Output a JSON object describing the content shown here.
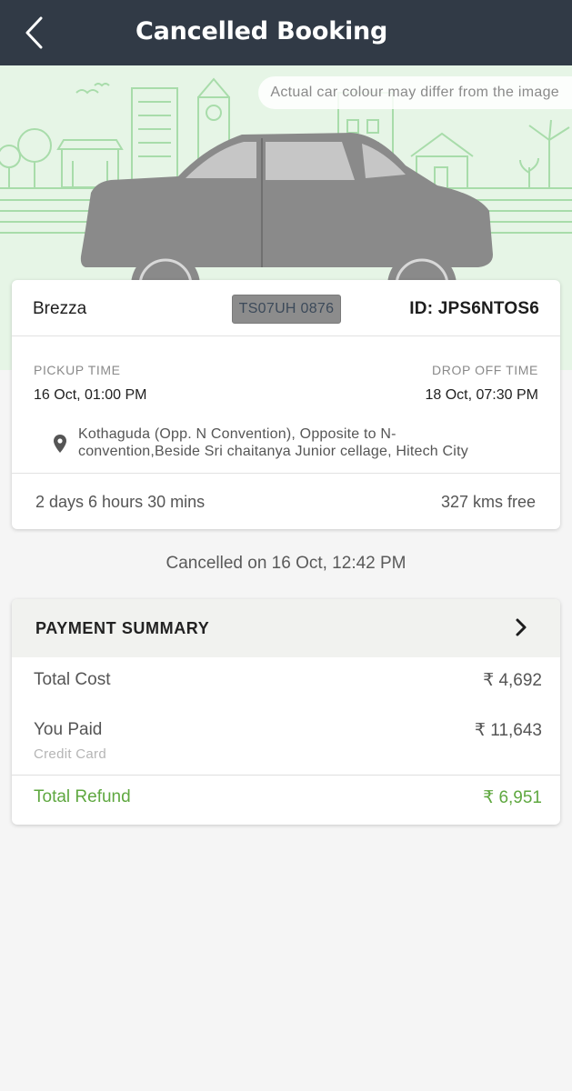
{
  "header": {
    "title": "Cancelled Booking",
    "back_icon": "chevron-left-icon"
  },
  "hero": {
    "note": "Actual car colour may differ from the image",
    "colors": {
      "background": "#e6f5e6",
      "lines": "#a8dcaa",
      "car": "#8a8a8a"
    }
  },
  "booking": {
    "car_name": "Brezza",
    "plate": "TS07UH 0876",
    "booking_id": "ID: JPS6NTOS6",
    "pickup_label": "PICKUP TIME",
    "pickup_time": "16 Oct, 01:00 PM",
    "dropoff_label": "DROP OFF TIME",
    "dropoff_time": "18 Oct, 07:30 PM",
    "location_icon": "location-pin-icon",
    "address_line1": "Kothaguda (Opp. N Convention), Opposite to N-",
    "address_line2": "convention,Beside Sri chaitanya Junior cellage, Hitech City",
    "duration": "2 days 6 hours 30 mins",
    "kms": "327 kms free"
  },
  "cancelled_on": "Cancelled on 16 Oct, 12:42 PM",
  "payment": {
    "title": "PAYMENT SUMMARY",
    "chevron_icon": "chevron-right-icon",
    "total_cost_label": "Total Cost",
    "total_cost_value": "₹ 4,692",
    "paid_label": "You Paid",
    "paid_value": "₹ 11,643",
    "paid_method": "Credit Card",
    "refund_label": "Total Refund",
    "refund_value": "₹ 6,951",
    "colors": {
      "refund": "#5fa840",
      "header_bg": "#313a46"
    }
  }
}
